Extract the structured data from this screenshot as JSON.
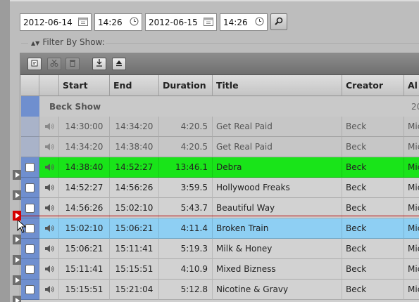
{
  "filter": {
    "start_date": "2012-06-14",
    "start_time": "14:26",
    "end_date": "2012-06-15",
    "end_time": "14:26",
    "section_label": "Filter By Show:"
  },
  "toolbar": {
    "buttons": [
      "edit-icon",
      "cut-icon",
      "trash-icon",
      "download-icon",
      "eject-icon"
    ]
  },
  "columns": [
    "Start",
    "End",
    "Duration",
    "Title",
    "Creator",
    "Al"
  ],
  "group": {
    "title": "Beck Show",
    "tail": "20"
  },
  "colors": {
    "playing": "#19e419",
    "selected": "#8ecff3",
    "live_marker": "#d40000"
  },
  "rows": [
    {
      "start": "14:30:00",
      "end": "14:34:20",
      "duration": "4:20.5",
      "title": "Get Real Paid",
      "creator": "Beck",
      "album": "Mic",
      "state": "past"
    },
    {
      "start": "14:34:20",
      "end": "14:38:40",
      "duration": "4:20.5",
      "title": "Get Real Paid",
      "creator": "Beck",
      "album": "Mic",
      "state": "past"
    },
    {
      "start": "14:38:40",
      "end": "14:52:27",
      "duration": "13:46.1",
      "title": "Debra",
      "creator": "Beck",
      "album": "Mic",
      "state": "playing"
    },
    {
      "start": "14:52:27",
      "end": "14:56:26",
      "duration": "3:59.5",
      "title": "Hollywood Freaks",
      "creator": "Beck",
      "album": "Mic",
      "state": "normal"
    },
    {
      "start": "14:56:26",
      "end": "15:02:10",
      "duration": "5:43.7",
      "title": "Beautiful Way",
      "creator": "Beck",
      "album": "Mic",
      "state": "normal"
    },
    {
      "start": "15:02:10",
      "end": "15:06:21",
      "duration": "4:11.4",
      "title": "Broken Train",
      "creator": "Beck",
      "album": "Mic",
      "state": "selected"
    },
    {
      "start": "15:06:21",
      "end": "15:11:41",
      "duration": "5:19.3",
      "title": "Milk & Honey",
      "creator": "Beck",
      "album": "Mic",
      "state": "normal"
    },
    {
      "start": "15:11:41",
      "end": "15:15:51",
      "duration": "4:10.9",
      "title": "Mixed Bizness",
      "creator": "Beck",
      "album": "Mic",
      "state": "normal"
    },
    {
      "start": "15:15:51",
      "end": "15:21:04",
      "duration": "5:12.8",
      "title": "Nicotine & Gravy",
      "creator": "Beck",
      "album": "Mic",
      "state": "normal"
    }
  ]
}
